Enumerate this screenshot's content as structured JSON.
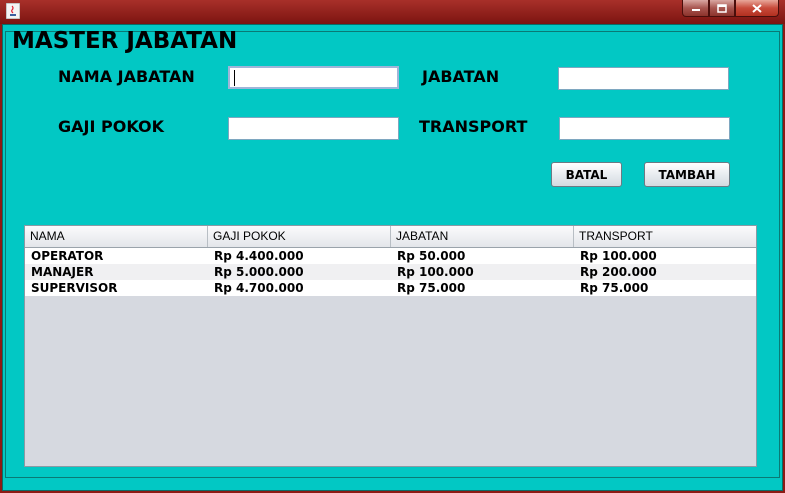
{
  "window": {
    "icon": "java-coffee-icon",
    "controls": {
      "minimize": "minimize-icon",
      "maximize": "maximize-icon",
      "close": "close-icon"
    }
  },
  "form": {
    "title": "MASTER JABATAN",
    "nama_jabatan": {
      "label": "NAMA JABATAN",
      "value": ""
    },
    "jabatan": {
      "label": "JABATAN",
      "value": ""
    },
    "gaji_pokok": {
      "label": "GAJI POKOK",
      "value": ""
    },
    "transport": {
      "label": "TRANSPORT",
      "value": ""
    },
    "buttons": {
      "batal": "BATAL",
      "tambah": "TAMBAH"
    }
  },
  "table": {
    "columns": [
      "NAMA",
      "GAJI POKOK",
      "JABATAN",
      "TRANSPORT"
    ],
    "rows": [
      [
        "OPERATOR",
        "Rp 4.400.000",
        "Rp 50.000",
        "Rp 100.000"
      ],
      [
        "MANAJER",
        "Rp 5.000.000",
        "Rp 100.000",
        "Rp 200.000"
      ],
      [
        "SUPERVISOR",
        "Rp 4.700.000",
        "Rp 75.000",
        "Rp 75.000"
      ]
    ]
  },
  "colors": {
    "panel_background": "#02c8c4",
    "titlebar": "#8e1a14",
    "table_empty_area": "#d6d9e0"
  }
}
